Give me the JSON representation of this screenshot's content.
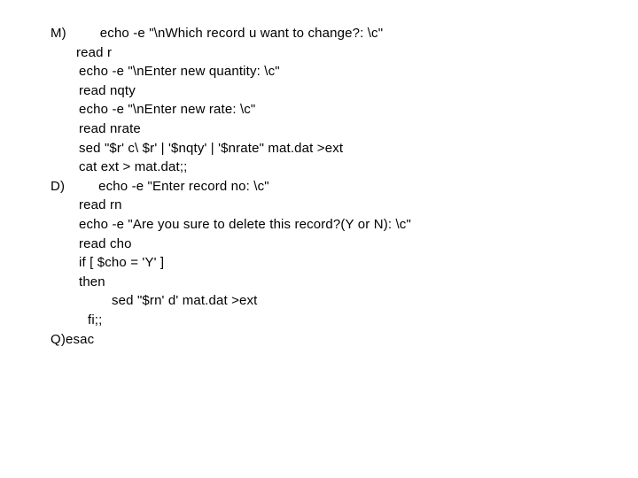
{
  "slide": {
    "background_color": "#ffffff",
    "text_color": "#000000",
    "lines": [
      {
        "id": "line-1",
        "label": "M)",
        "text": "echo -e \"\\nWhich record u want to change?: \\c\"",
        "indent": "label"
      },
      {
        "id": "line-2",
        "label": "",
        "text": "read r",
        "indent": "read"
      },
      {
        "id": "line-3",
        "label": "",
        "text": "echo -e \"\\nEnter new quantity: \\c\"",
        "indent": "body"
      },
      {
        "id": "line-4",
        "label": "",
        "text": "read nqty",
        "indent": "body"
      },
      {
        "id": "line-5",
        "label": "",
        "text": "echo -e \"\\nEnter new rate: \\c\"",
        "indent": "body"
      },
      {
        "id": "line-6",
        "label": "",
        "text": "read nrate",
        "indent": "body"
      },
      {
        "id": "line-7",
        "label": "",
        "text": "sed \"$r' c\\ $r' | '$nqty' | '$nrate\" mat.dat >ext",
        "indent": "body"
      },
      {
        "id": "line-8",
        "label": "",
        "text": "cat ext > mat.dat;;",
        "indent": "body"
      },
      {
        "id": "line-9",
        "label": "D)",
        "text": "echo -e \"Enter record no: \\c\"",
        "indent": "label"
      },
      {
        "id": "line-10",
        "label": "",
        "text": "read rn",
        "indent": "body"
      },
      {
        "id": "line-11",
        "label": "",
        "text": "echo -e \"Are you sure to delete this record?(Y or N): \\c\"",
        "indent": "body"
      },
      {
        "id": "line-12",
        "label": "",
        "text": "read cho",
        "indent": "body"
      },
      {
        "id": "line-13",
        "label": "",
        "text": "if [ $cho = 'Y' ]",
        "indent": "body"
      },
      {
        "id": "line-14",
        "label": "",
        "text": "then",
        "indent": "body"
      },
      {
        "id": "line-15",
        "label": "",
        "text": "sed \"$rn' d' mat.dat >ext",
        "indent": "deep"
      },
      {
        "id": "line-16",
        "label": "",
        "text": "fi;;",
        "indent": "fi"
      },
      {
        "id": "line-17",
        "label": "",
        "text": "Q)esac",
        "indent": "esac"
      }
    ]
  }
}
